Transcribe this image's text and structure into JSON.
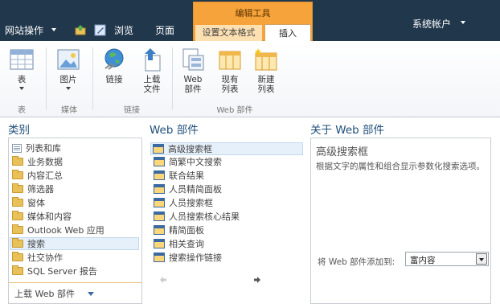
{
  "topbar": {
    "site_actions": "网站操作",
    "browse": "浏览",
    "page": "页面",
    "context_group": "编辑工具",
    "tab_format": "设置文本格式",
    "tab_insert": "插入",
    "account": "系统帐户"
  },
  "ribbon": {
    "buttons": {
      "table": "表",
      "picture": "图片",
      "link": "链接",
      "upload_line1": "上载",
      "upload_line2": "文件",
      "webpart_line1": "Web",
      "webpart_line2": "部件",
      "existing_line1": "现有",
      "existing_line2": "列表",
      "newlist_line1": "新建",
      "newlist_line2": "列表"
    },
    "groups": {
      "tables": "表",
      "media": "媒体",
      "links": "链接",
      "webparts": "Web 部件"
    }
  },
  "categories": {
    "title": "类别",
    "items": [
      "列表和库",
      "业务数据",
      "内容汇总",
      "筛选器",
      "窗体",
      "媒体和内容",
      "Outlook Web 应用",
      "搜索",
      "社交协作",
      "SQL Server 报告"
    ],
    "selected_index": 7,
    "upload_label": "上载 Web 部件"
  },
  "webparts": {
    "title": "Web 部件",
    "items": [
      "高级搜索框",
      "简繁中文搜索",
      "联合结果",
      "人员精简面板",
      "人员搜索框",
      "人员搜索核心结果",
      "精简面板",
      "相关查询",
      "搜索操作链接"
    ],
    "selected_index": 0
  },
  "about": {
    "title": "关于 Web 部件",
    "name": "高级搜索框",
    "description": "根据文字的属性和组合显示参数化搜索选项。",
    "add_label": "将 Web 部件添加到:",
    "zone_value": "富内容"
  }
}
